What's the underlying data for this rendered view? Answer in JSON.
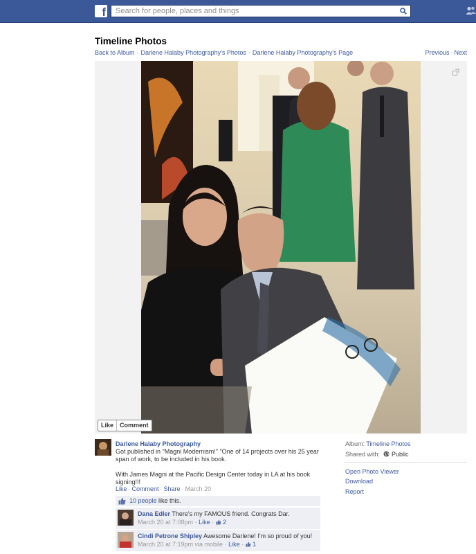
{
  "topbar": {
    "logo": "f",
    "search_placeholder": "Search for people, places and things"
  },
  "header": {
    "title": "Timeline Photos",
    "breadcrumbs": [
      "Back to Album",
      "Darlene Halaby Photography's Photos",
      "Darlene Halaby Photography's Page"
    ],
    "previous": "Previous",
    "next": "Next"
  },
  "photo": {
    "like": "Like",
    "comment": "Comment"
  },
  "post": {
    "author": "Darlene Halaby Photography",
    "text_1": "Got published in \"Magni Modernism!\" \"One of 14 projects over his 25 year span of work, to be included in his book.",
    "text_2": "With James Magni at the Pacific Design Center today in LA at his book signing!!!",
    "actions": {
      "like": "Like",
      "comment": "Comment",
      "share": "Share",
      "date": "March 20"
    },
    "likes_link": "10 people",
    "likes_suffix": " like this.",
    "comments": [
      {
        "name": "Dana Edler",
        "text": "There's my FAMOUS friend. Congrats Dar.",
        "time": "March 20 at 7:08pm",
        "like": "Like",
        "like_count": "2"
      },
      {
        "name": "Cindi Petrone Shipley",
        "text": "Awesome Darlene! I'm so proud of you!",
        "time": "March 20 at 7:19pm via mobile",
        "like": "Like",
        "like_count": "1"
      }
    ]
  },
  "sidebar": {
    "album_label": "Album:",
    "album_value": "Timeline Photos",
    "shared_label": "Shared with:",
    "shared_value": "Public",
    "links": [
      "Open Photo Viewer",
      "Download",
      "Report"
    ]
  },
  "colors": {
    "brand": "#3b5998",
    "comment_bg": "#edeff4",
    "stage_bg": "#f2f2f2"
  }
}
